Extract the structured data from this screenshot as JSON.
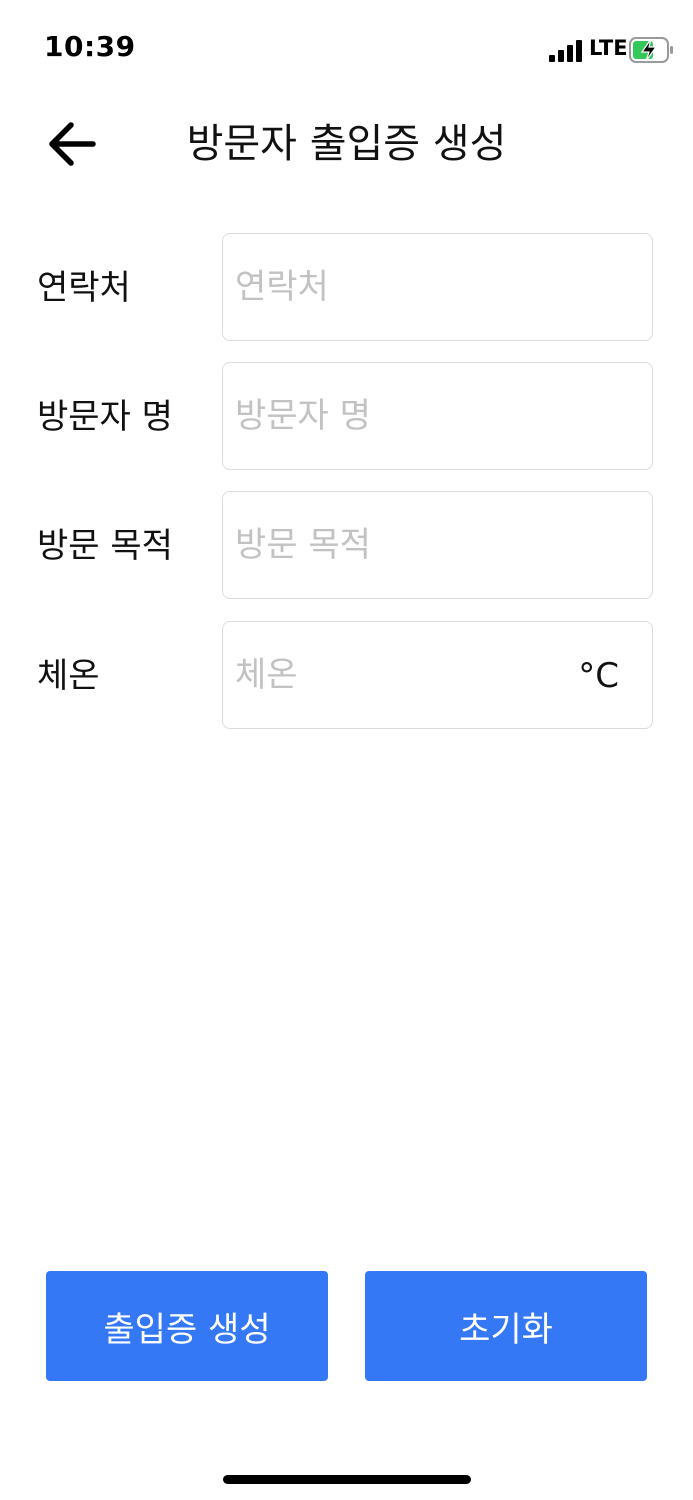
{
  "status_bar": {
    "time": "10:39",
    "network": "LTE",
    "battery_color": "#34c759"
  },
  "header": {
    "back_icon": "arrow-left-icon",
    "title": "방문자 출입증 생성"
  },
  "form": {
    "contact": {
      "label": "연락처",
      "placeholder": "연락처",
      "value": ""
    },
    "visitor_name": {
      "label": "방문자 명",
      "placeholder": "방문자 명",
      "value": ""
    },
    "visit_purpose": {
      "label": "방문 목적",
      "placeholder": "방문 목적",
      "value": ""
    },
    "temperature": {
      "label": "체온",
      "placeholder": "체온",
      "value": "",
      "unit": "°C"
    }
  },
  "actions": {
    "create_label": "출입증 생성",
    "reset_label": "초기화",
    "button_color": "#3478f6"
  }
}
